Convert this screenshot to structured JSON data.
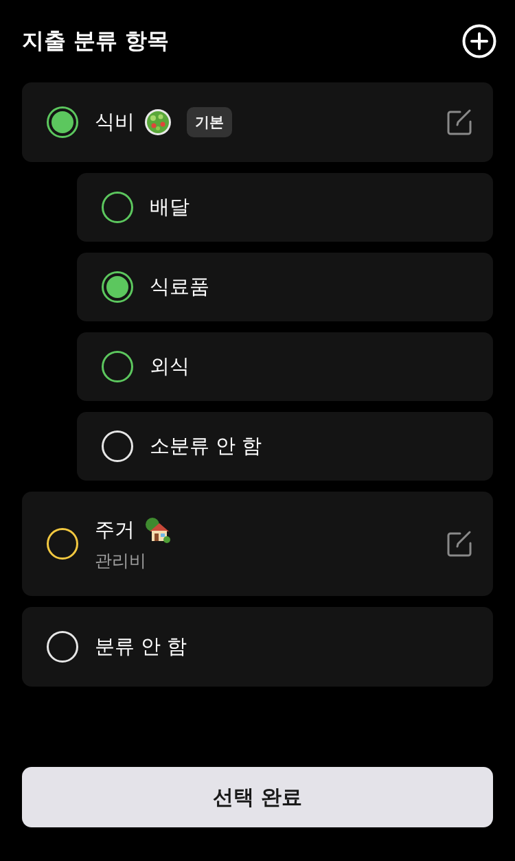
{
  "header": {
    "title": "지출 분류 항목"
  },
  "categories": [
    {
      "kind": "category",
      "name": "식비",
      "selected": true,
      "color": "#5cc75e",
      "badge": "기본",
      "editable": true,
      "children": [
        {
          "name": "배달",
          "selected": false,
          "color": "#5cc75e"
        },
        {
          "name": "식료품",
          "selected": true,
          "color": "#5cc75e"
        },
        {
          "name": "외식",
          "selected": false,
          "color": "#5cc75e"
        },
        {
          "name": "소분류 안 함",
          "selected": false,
          "color": "#e6e6e6"
        }
      ]
    },
    {
      "kind": "category",
      "name": "주거",
      "selected": false,
      "color": "#f2c840",
      "subtitle": "관리비",
      "editable": true
    },
    {
      "kind": "none",
      "name": "분류 안 함",
      "selected": false,
      "color": "#e6e6e6"
    }
  ],
  "confirm_button": "선택 완료"
}
